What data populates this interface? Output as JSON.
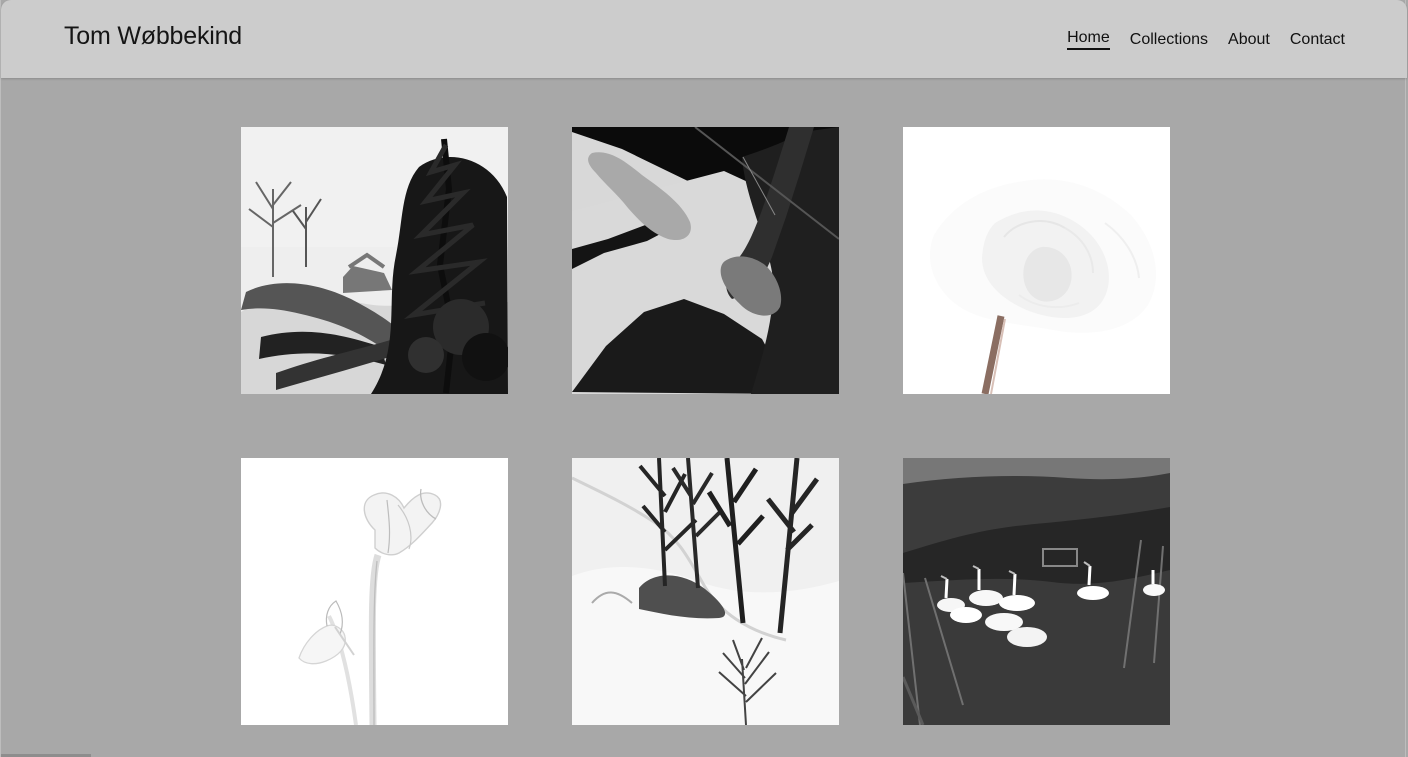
{
  "site": {
    "title": "Tom Wøbbekind"
  },
  "nav": {
    "items": [
      {
        "label": "Home",
        "active": true
      },
      {
        "label": "Collections",
        "active": false
      },
      {
        "label": "About",
        "active": false
      },
      {
        "label": "Contact",
        "active": false
      }
    ]
  },
  "gallery": {
    "images": [
      {
        "subject": "snowy-garden-trees-photo"
      },
      {
        "subject": "bare-feet-shadow-photo"
      },
      {
        "subject": "white-flower-photo"
      },
      {
        "subject": "amaryllis-flower-photo"
      },
      {
        "subject": "snowy-birch-trees-photo"
      },
      {
        "subject": "geese-farmyard-photo"
      }
    ]
  },
  "colors": {
    "header_bg": "#cccccc",
    "page_bg": "#a8a8a8",
    "text": "#111111"
  }
}
